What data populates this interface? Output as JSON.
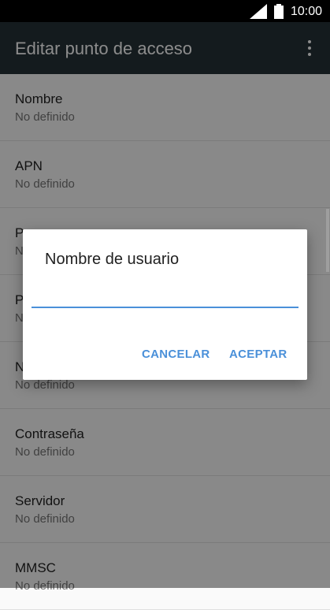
{
  "status_bar": {
    "time": "10:00",
    "signal_icon": "cell-signal-icon",
    "battery_icon": "battery-icon"
  },
  "app_bar": {
    "title": "Editar punto de acceso",
    "menu_icon": "more-vert-icon"
  },
  "settings": [
    {
      "label": "Nombre",
      "value": "No definido"
    },
    {
      "label": "APN",
      "value": "No definido"
    },
    {
      "label": "P",
      "value": "N"
    },
    {
      "label": "P",
      "value": "N"
    },
    {
      "label": "N",
      "value": "No definido"
    },
    {
      "label": "Contraseña",
      "value": "No definido"
    },
    {
      "label": "Servidor",
      "value": "No definido"
    },
    {
      "label": "MMSC",
      "value": "No definido"
    }
  ],
  "dialog": {
    "title": "Nombre de usuario",
    "input_value": "",
    "cancel_label": "CANCELAR",
    "ok_label": "ACEPTAR"
  },
  "colors": {
    "app_bar": "#263238",
    "accent": "#4a90d9"
  }
}
